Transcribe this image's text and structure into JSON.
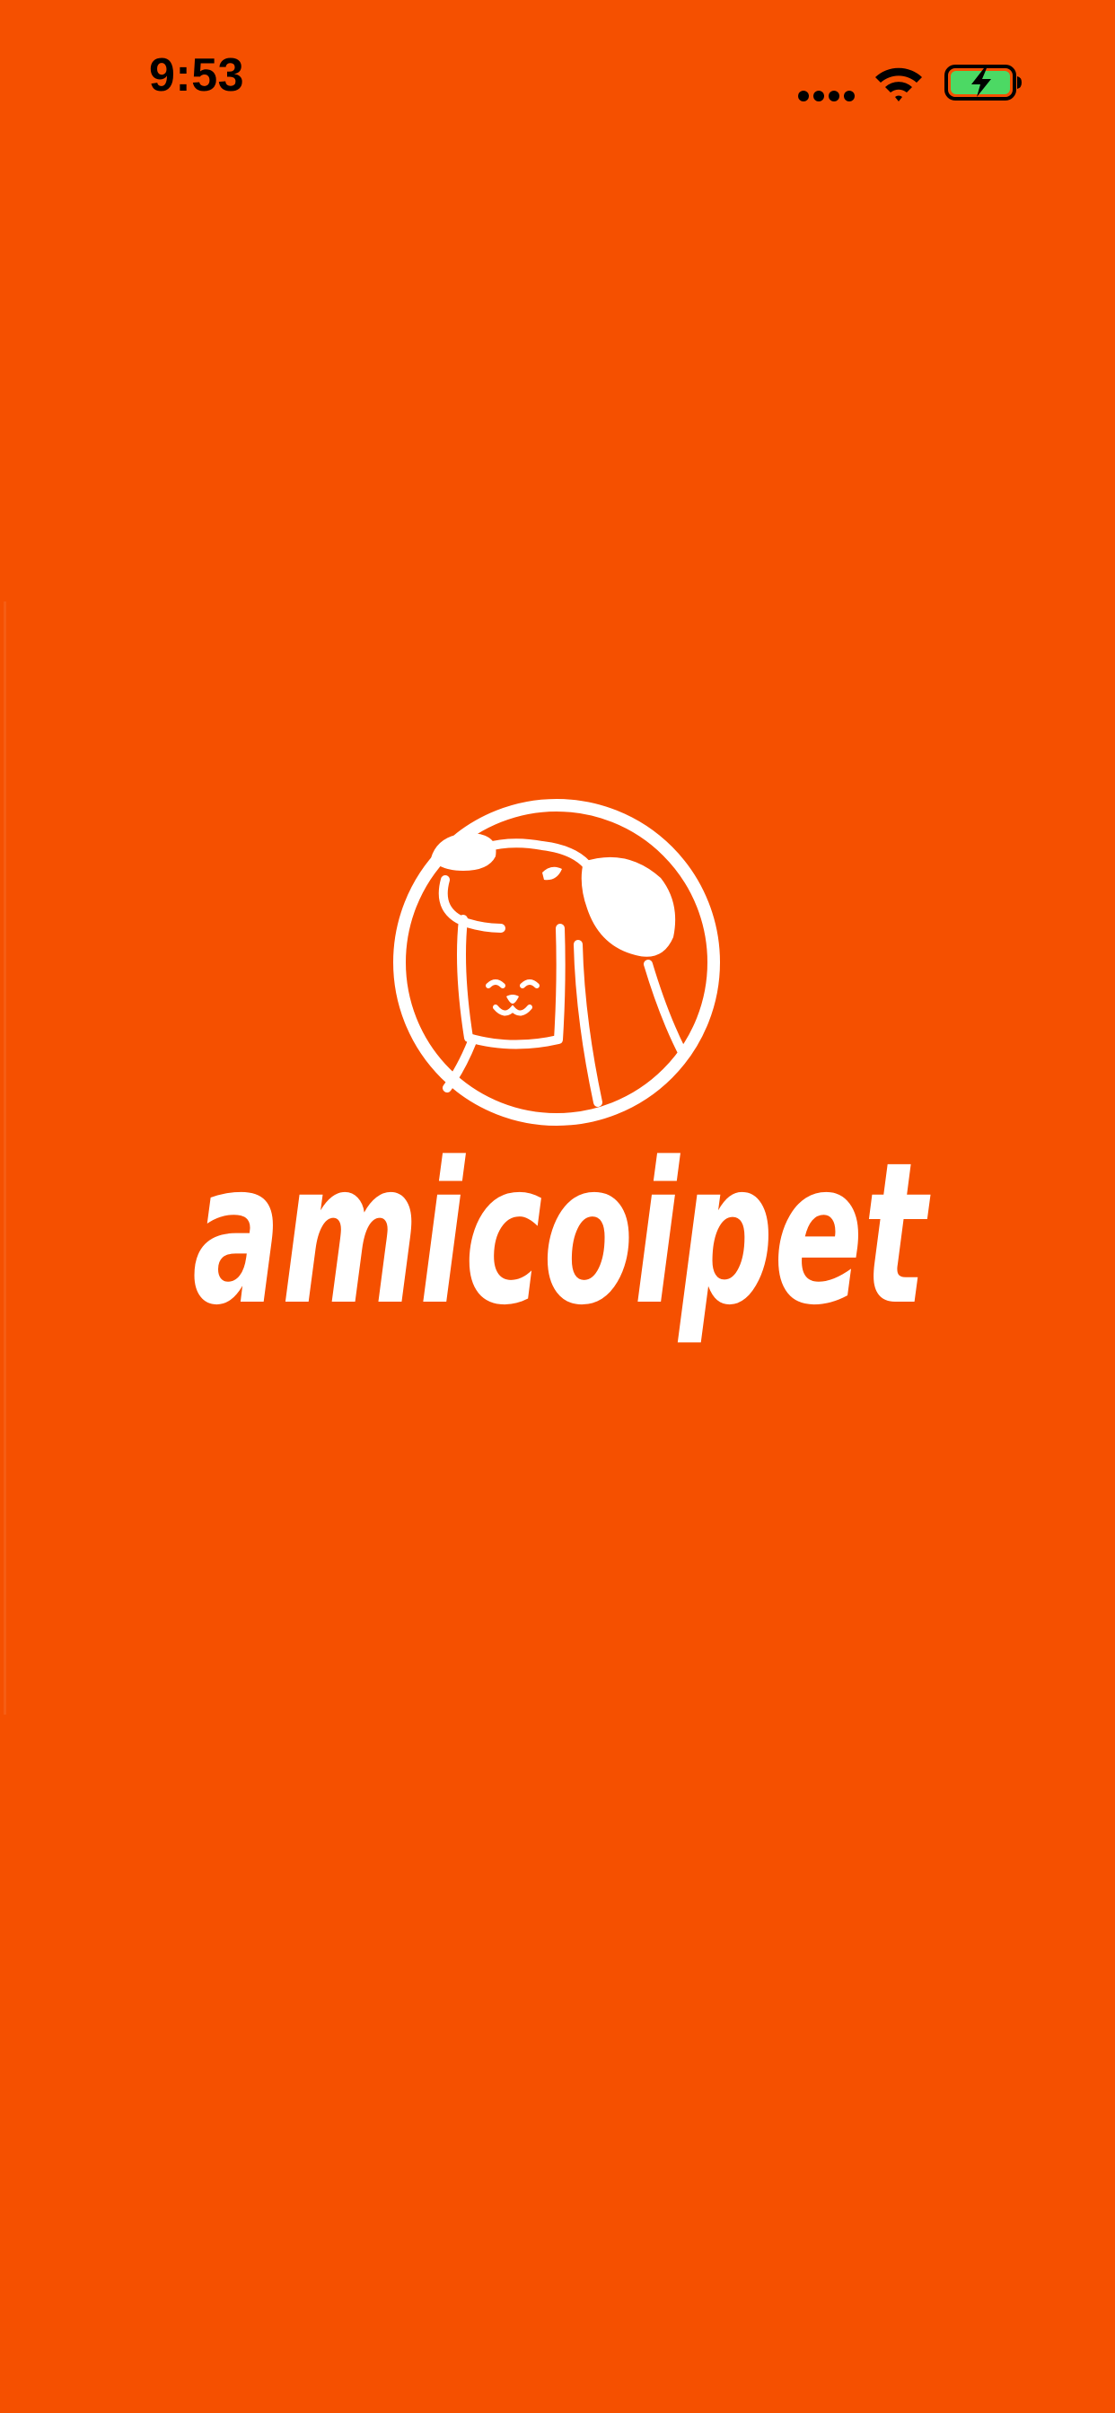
{
  "colors": {
    "background": "#F55000",
    "logo": "#FFFFFF",
    "status_text": "#000000",
    "battery_fill": "#4CD964"
  },
  "status_bar": {
    "time": "9:53",
    "signal_icon": "cellular-signal-icon",
    "wifi_icon": "wifi-icon",
    "battery_icon": "battery-charging-icon"
  },
  "splash": {
    "brand_name": "amicoipet",
    "emblem_icon": "dog-cat-emblem-icon"
  }
}
